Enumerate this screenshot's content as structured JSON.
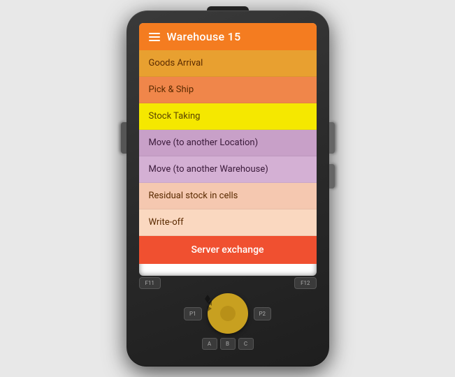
{
  "device": {
    "bg_color": "#2a2a2a"
  },
  "header": {
    "title": "Warehouse 15",
    "menu_icon": "hamburger"
  },
  "menu": {
    "items": [
      {
        "label": "Goods Arrival",
        "color_class": "menu-item-1"
      },
      {
        "label": "Pick & Ship",
        "color_class": "menu-item-2"
      },
      {
        "label": "Stock Taking",
        "color_class": "menu-item-3"
      },
      {
        "label": "Move (to another Location)",
        "color_class": "menu-item-4"
      },
      {
        "label": "Move (to another Warehouse)",
        "color_class": "menu-item-5"
      },
      {
        "label": "Residual stock in cells",
        "color_class": "menu-item-6"
      },
      {
        "label": "Write-off",
        "color_class": "menu-item-7"
      }
    ],
    "server_exchange": "Server exchange"
  },
  "keypad": {
    "fn_left": "F11",
    "fn_right": "F12",
    "p1": "P1",
    "p2": "P2",
    "letters": [
      "A",
      "B",
      "C"
    ]
  }
}
